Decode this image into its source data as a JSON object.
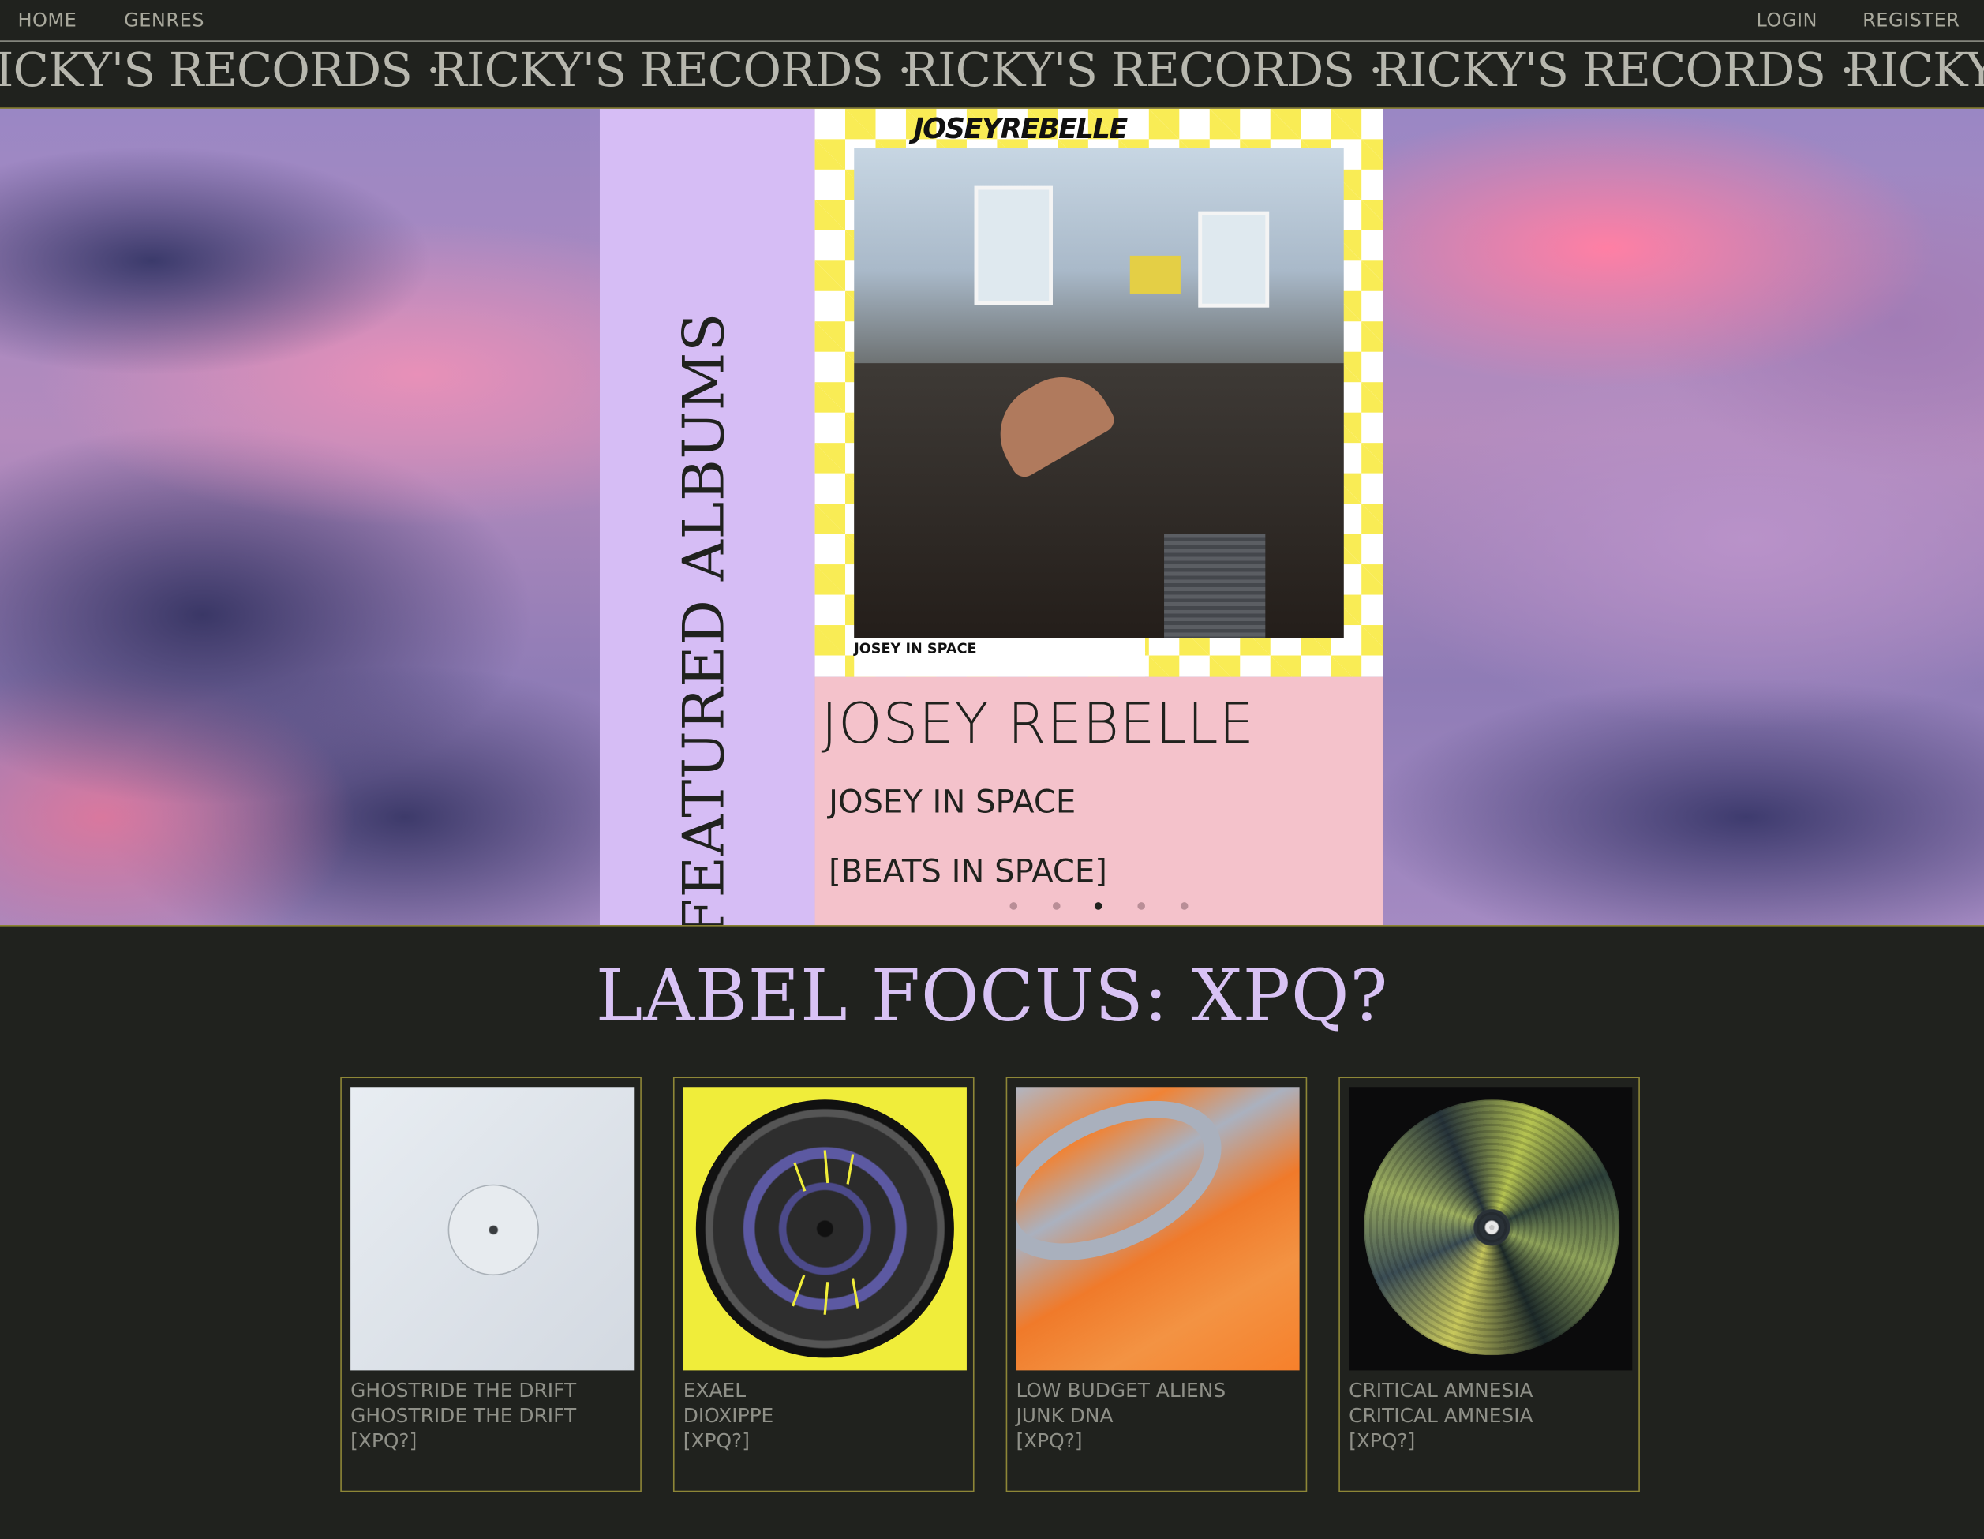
{
  "nav": {
    "home": "HOME",
    "genres": "GENRES",
    "login": "LOGIN",
    "register": "REGISTER"
  },
  "marquee": {
    "segments": [
      "RICKY'S RECORDS ·",
      "RICKY'S RECORDS ·",
      "RICKY'S RECORDS ·",
      "RICKY'S RECORDS ·",
      "RICKY'S RECORDS ·"
    ]
  },
  "featured": {
    "heading": "FEATURED ALBUMS",
    "cover_signature": "JOSEYREBELLE",
    "cover_caption": "JOSEY IN SPACE",
    "artist": "JOSEY REBELLE",
    "title": "JOSEY IN SPACE",
    "label": "[BEATS IN SPACE]",
    "slide_count": 5,
    "active_slide": 3
  },
  "label_focus": {
    "heading": "LABEL FOCUS: XPQ?",
    "albums": [
      {
        "artist": "GHOSTRIDE THE DRIFT",
        "title": "GHOSTRIDE THE DRIFT",
        "label": "[XPQ?]",
        "cover": "white-label-vinyl"
      },
      {
        "artist": "EXAEL",
        "title": "DIOXIPPE",
        "label": "[XPQ?]",
        "cover": "yellow-vinyl"
      },
      {
        "artist": "LOW BUDGET ALIENS",
        "title": "JUNK DNA",
        "label": "[XPQ?]",
        "cover": "orange-abstract"
      },
      {
        "artist": "CRITICAL AMNESIA",
        "title": "CRITICAL AMNESIA",
        "label": "[XPQ?]",
        "cover": "picture-disc"
      }
    ]
  },
  "colors": {
    "background": "#20221e",
    "accent_lilac": "#d6bdf5",
    "accent_pink": "#f4c2cb",
    "border_gold": "#8c8433",
    "muted_text": "#8f9088"
  }
}
